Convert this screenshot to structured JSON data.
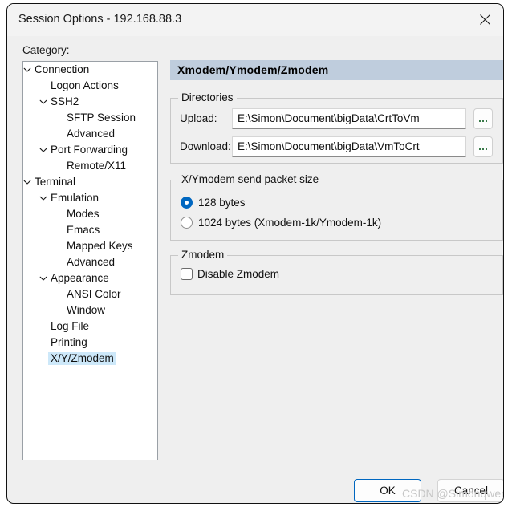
{
  "window": {
    "title": "Session Options - 192.168.88.3",
    "close_icon": "close-icon"
  },
  "sidebar": {
    "label": "Category:",
    "items": [
      {
        "label": "Connection",
        "depth": 0,
        "expandable": true,
        "selected": false
      },
      {
        "label": "Logon Actions",
        "depth": 1,
        "expandable": false,
        "selected": false
      },
      {
        "label": "SSH2",
        "depth": 1,
        "expandable": true,
        "selected": false
      },
      {
        "label": "SFTP Session",
        "depth": 2,
        "expandable": false,
        "selected": false
      },
      {
        "label": "Advanced",
        "depth": 2,
        "expandable": false,
        "selected": false
      },
      {
        "label": "Port Forwarding",
        "depth": 1,
        "expandable": true,
        "selected": false
      },
      {
        "label": "Remote/X11",
        "depth": 2,
        "expandable": false,
        "selected": false
      },
      {
        "label": "Terminal",
        "depth": 0,
        "expandable": true,
        "selected": false
      },
      {
        "label": "Emulation",
        "depth": 1,
        "expandable": true,
        "selected": false
      },
      {
        "label": "Modes",
        "depth": 2,
        "expandable": false,
        "selected": false
      },
      {
        "label": "Emacs",
        "depth": 2,
        "expandable": false,
        "selected": false
      },
      {
        "label": "Mapped Keys",
        "depth": 2,
        "expandable": false,
        "selected": false
      },
      {
        "label": "Advanced",
        "depth": 2,
        "expandable": false,
        "selected": false
      },
      {
        "label": "Appearance",
        "depth": 1,
        "expandable": true,
        "selected": false
      },
      {
        "label": "ANSI Color",
        "depth": 2,
        "expandable": false,
        "selected": false
      },
      {
        "label": "Window",
        "depth": 2,
        "expandable": false,
        "selected": false
      },
      {
        "label": "Log File",
        "depth": 1,
        "expandable": false,
        "selected": false
      },
      {
        "label": "Printing",
        "depth": 1,
        "expandable": false,
        "selected": false
      },
      {
        "label": "X/Y/Zmodem",
        "depth": 1,
        "expandable": false,
        "selected": true
      }
    ]
  },
  "content": {
    "header": "Xmodem/Ymodem/Zmodem",
    "directories": {
      "legend": "Directories",
      "upload_label": "Upload:",
      "upload_value": "E:\\Simon\\Document\\bigData\\CrtToVm",
      "download_label": "Download:",
      "download_value": "E:\\Simon\\Document\\bigData\\VmToCrt",
      "browse_label": "..."
    },
    "packet_size": {
      "legend": "X/Ymodem send packet size",
      "options": [
        {
          "label": "128 bytes",
          "checked": true
        },
        {
          "label": "1024 bytes  (Xmodem-1k/Ymodem-1k)",
          "checked": false
        }
      ]
    },
    "zmodem": {
      "legend": "Zmodem",
      "disable_label": "Disable Zmodem",
      "disable_checked": false
    }
  },
  "footer": {
    "ok_label": "OK",
    "cancel_label": "Cancel"
  },
  "watermark": "CSDN @Simonqwer",
  "colors": {
    "header_bar": "#bfcddd",
    "selection": "#cde8f9",
    "accent": "#0067c0",
    "dialog_bg": "#efefef"
  }
}
